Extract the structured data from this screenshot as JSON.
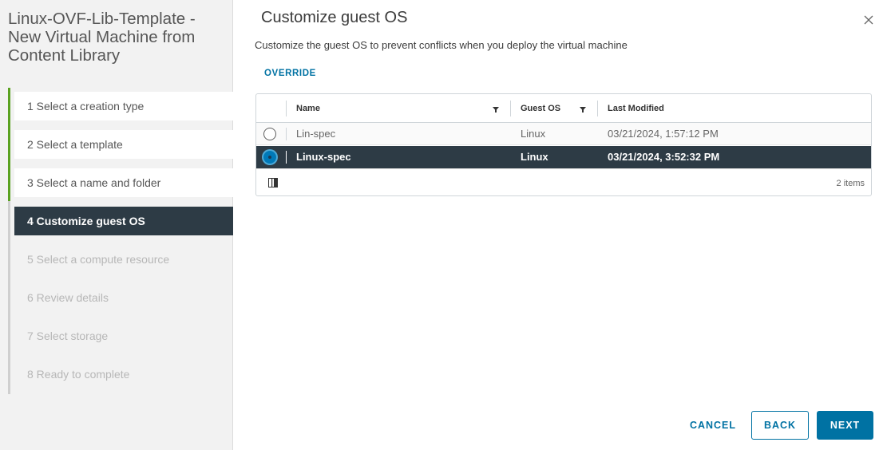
{
  "wizard": {
    "title": "Linux-OVF-Lib-Template - New Virtual Machine from Content Library",
    "steps": [
      {
        "label": "1  Select a creation type",
        "state": "done"
      },
      {
        "label": "2  Select a template",
        "state": "done"
      },
      {
        "label": "3  Select a name and folder",
        "state": "done"
      },
      {
        "label": "4  Customize guest OS",
        "state": "active"
      },
      {
        "label": "5  Select a compute resource",
        "state": "future"
      },
      {
        "label": "6  Review details",
        "state": "future"
      },
      {
        "label": "7  Select storage",
        "state": "future"
      },
      {
        "label": "8  Ready to complete",
        "state": "future"
      }
    ]
  },
  "main": {
    "title": "Customize guest OS",
    "subtitle": "Customize the guest OS to prevent conflicts when you deploy the virtual machine",
    "override_label": "OVERRIDE"
  },
  "grid": {
    "columns": [
      "Name",
      "Guest OS",
      "Last Modified"
    ],
    "rows": [
      {
        "name": "Lin-spec",
        "guest_os": "Linux",
        "last_modified": "03/21/2024, 1:57:12 PM",
        "selected": false
      },
      {
        "name": "Linux-spec",
        "guest_os": "Linux",
        "last_modified": "03/21/2024, 3:52:32 PM",
        "selected": true
      }
    ],
    "footer_count": "2 items"
  },
  "buttons": {
    "cancel": "CANCEL",
    "back": "BACK",
    "next": "NEXT"
  },
  "colors": {
    "accent": "#0072a3",
    "selected_row": "#2d3b45",
    "progress_green": "#5aa220"
  },
  "icons": {
    "close": "close-icon",
    "filter": "filter-icon",
    "column_toggle": "column-toggle-icon"
  }
}
